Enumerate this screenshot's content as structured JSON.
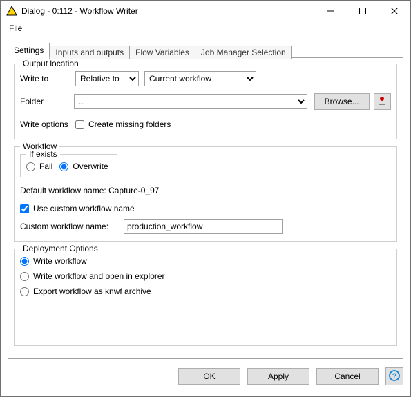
{
  "window": {
    "title": "Dialog - 0:112 - Workflow Writer"
  },
  "menu": {
    "file": "File"
  },
  "tabs": {
    "settings": "Settings",
    "io": "Inputs and outputs",
    "flow_vars": "Flow Variables",
    "job_mgr": "Job Manager Selection"
  },
  "groups": {
    "output_location": "Output location",
    "workflow": "Workflow",
    "if_exists": "If exists",
    "deployment": "Deployment Options"
  },
  "output": {
    "write_to_label": "Write to",
    "write_to_mode": "Relative to",
    "write_to_target": "Current workflow",
    "folder_label": "Folder",
    "folder_value": "..",
    "browse_label": "Browse...",
    "write_options_label": "Write options",
    "create_missing_label": "Create missing folders",
    "create_missing_checked": false
  },
  "workflow": {
    "if_exists_fail": "Fail",
    "if_exists_overwrite": "Overwrite",
    "if_exists_selected": "overwrite",
    "default_name_label": "Default workflow name: ",
    "default_name_value": "Capture-0_97",
    "use_custom_checked": true,
    "use_custom_label": "Use custom workflow name",
    "custom_name_label": "Custom workflow name:",
    "custom_name_value": "production_workflow"
  },
  "deployment": {
    "opt_write": "Write workflow",
    "opt_open": "Write workflow and open in explorer",
    "opt_export": "Export workflow as knwf archive",
    "selected": "write"
  },
  "footer": {
    "ok": "OK",
    "apply": "Apply",
    "cancel": "Cancel"
  },
  "icons": {
    "app": "app-triangle-icon",
    "flow_var": "flow-variable-icon",
    "help": "help-icon"
  }
}
